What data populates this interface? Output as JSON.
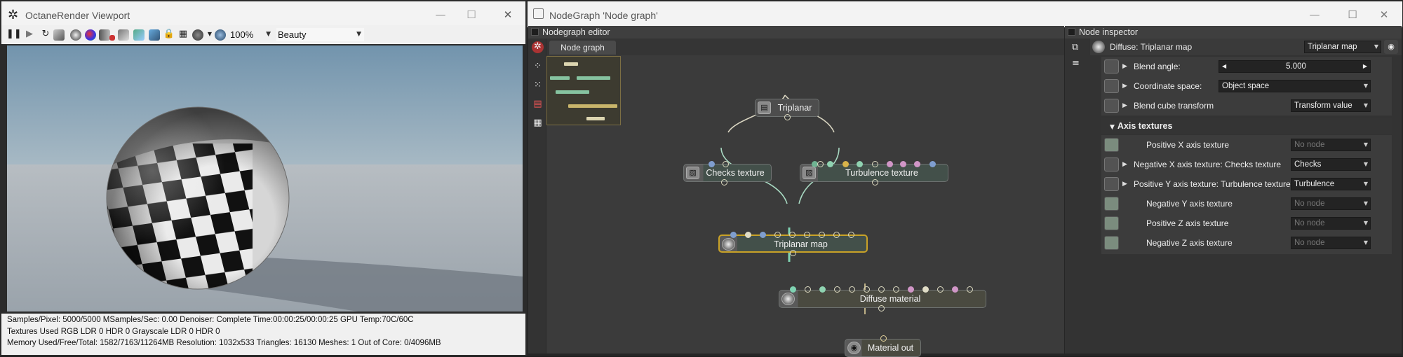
{
  "viewport": {
    "title": "OctaneRender Viewport",
    "zoom": "100%",
    "render_pass": "Beauty",
    "status_lines": [
      "Samples/Pixel: 5000/5000   MSamples/Sec: 0.00   Denoiser: Complete   Time:00:00:25/00:00:25   GPU Temp:70C/60C",
      "Textures Used RGB LDR 0   HDR 0   Grayscale LDR 0   HDR 0",
      "Memory Used/Free/Total: 1582/7163/11264MB   Resolution: 1032x533   Triangles: 16130   Meshes: 1 Out of Core: 0/4096MB"
    ]
  },
  "nodegraph_window": {
    "title": "NodeGraph 'Node graph'",
    "editor_panel_title": "Nodegraph editor",
    "tab": "Node graph",
    "nodes": {
      "triplanar": "Triplanar",
      "checks": "Checks texture",
      "turbulence": "Turbulence texture",
      "triplanar_map": "Triplanar map",
      "diffuse": "Diffuse material",
      "material_out": "Material out"
    }
  },
  "inspector": {
    "panel_title": "Node inspector",
    "header_label": "Diffuse: Triplanar map",
    "header_value": "Triplanar map",
    "rows": [
      {
        "label": "Blend angle:",
        "value": "5.000"
      },
      {
        "label": "Coordinate space:",
        "value": "Object space"
      },
      {
        "label": "Blend cube transform",
        "value": "Transform value"
      }
    ],
    "section_title": "Axis textures",
    "axis_rows": [
      {
        "label": "Positive X axis texture",
        "value": "No node"
      },
      {
        "label": "Negative X axis texture: Checks texture",
        "value": "Checks"
      },
      {
        "label": "Positive Y axis texture: Turbulence texture",
        "value": "Turbulence"
      },
      {
        "label": "Negative Y axis texture",
        "value": "No node"
      },
      {
        "label": "Positive Z axis texture",
        "value": "No node"
      },
      {
        "label": "Negative Z axis texture",
        "value": "No node"
      }
    ]
  },
  "colors": {
    "node_body": "#43504a",
    "selected_border": "#c9a227",
    "wire": "#d8d4c0",
    "selected_wire": "#7fd3b2",
    "inspector_green": "#7b8c7e"
  },
  "icons": [
    "pause-icon",
    "play-icon",
    "refresh-icon",
    "gear-icon",
    "eye-icon",
    "expand-icon",
    "checkbox-icon"
  ]
}
